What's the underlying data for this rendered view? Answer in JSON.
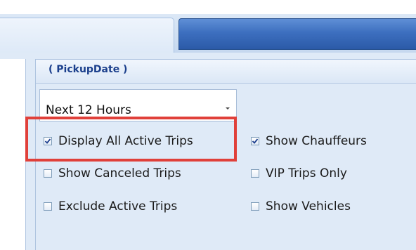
{
  "panel": {
    "title": "( PickupDate )"
  },
  "range_select": {
    "value": "Next 12 Hours"
  },
  "options": {
    "display_all_active": {
      "label": "Display All Active Trips",
      "checked": true
    },
    "show_canceled": {
      "label": "Show Canceled Trips",
      "checked": false
    },
    "exclude_active": {
      "label": "Exclude Active Trips",
      "checked": false
    },
    "show_chauffeurs": {
      "label": "Show Chauffeurs",
      "checked": true
    },
    "vip_only": {
      "label": "VIP Trips Only",
      "checked": false
    },
    "show_vehicles": {
      "label": "Show Vehicles",
      "checked": false
    }
  },
  "annotation": {
    "highlight_color": "#e0403a"
  },
  "icons": {
    "checkmark": "check-icon",
    "dropdown": "chevron-down-icon"
  }
}
